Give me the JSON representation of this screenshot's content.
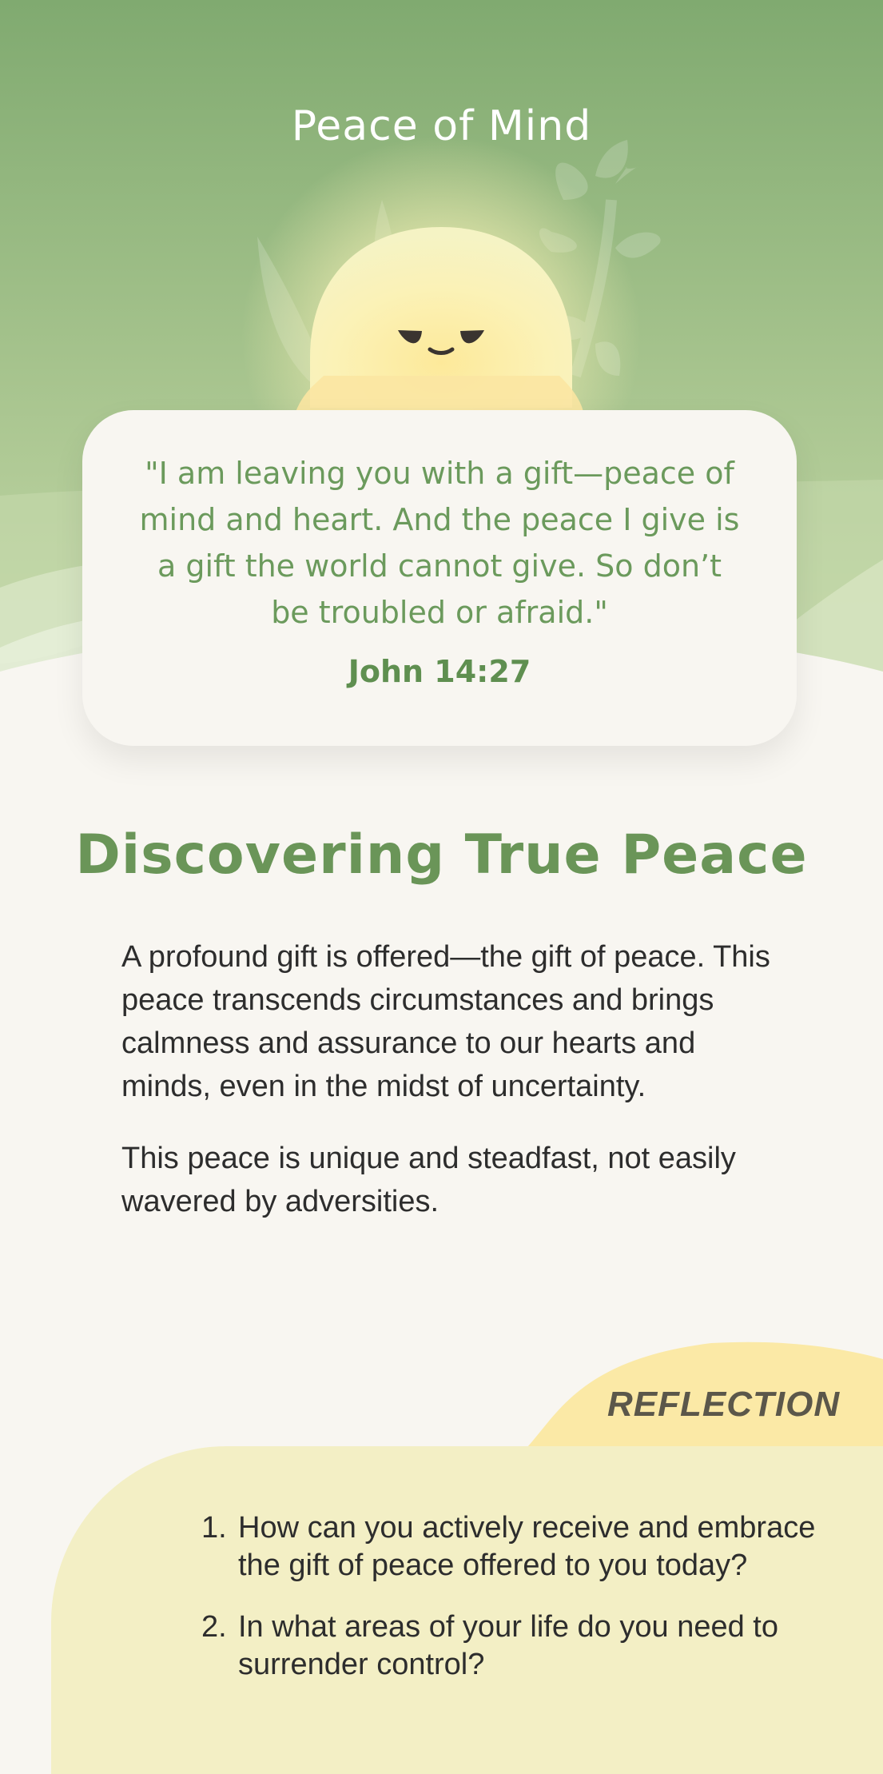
{
  "header": {
    "title": "Peace of Mind"
  },
  "quote": {
    "text": "\"I am leaving you with a gift—peace of mind and heart. And the peace I give is a gift the world cannot give. So don’t be troubled or afraid.\"",
    "reference": "John 14:27"
  },
  "article": {
    "heading": "Discovering True Peace",
    "paragraphs": [
      "A profound gift is offered—the gift of peace. This peace transcends circumstances and brings calmness and assurance to our hearts and minds, even in the midst of uncertainty.",
      "This peace is unique and steadfast, not easily wavered by adversities."
    ]
  },
  "reflection": {
    "label": "REFLECTION",
    "questions": [
      {
        "number": "1.",
        "text": "How can you actively receive and embrace the gift of peace offered to you today?"
      },
      {
        "number": "2.",
        "text": "In what areas of your life do you need to surrender control?"
      }
    ]
  },
  "colors": {
    "hero_green": "#86ad74",
    "accent_green": "#6a9558",
    "background": "#f8f6f1",
    "reflection_yellow": "#f3efc5",
    "reflection_tab": "#fbe9a6"
  },
  "icons": {
    "mascot": "peaceful-sun-face-icon",
    "leaves": "leaf-branch-icon"
  }
}
